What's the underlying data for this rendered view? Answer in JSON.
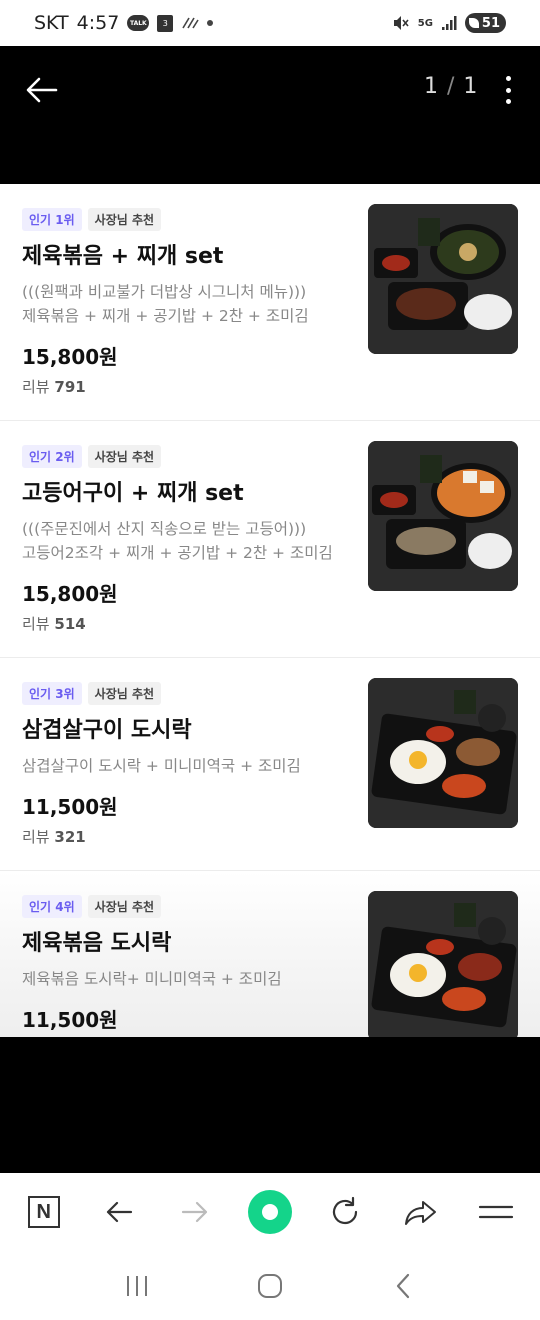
{
  "status_bar": {
    "carrier": "SKT",
    "time": "4:57",
    "talk_badge": "TALK",
    "calendar_day": "3",
    "network": "5G",
    "battery": "51"
  },
  "viewer": {
    "page_current": "1",
    "page_total": "1",
    "page_separator": "/"
  },
  "menu_items": [
    {
      "rank_badge": "인기 1위",
      "owner_badge": "사장님 추천",
      "title": "제육볶음 + 찌개 set",
      "desc_line1": "(((원팩과 비교불가 더밥상 시그니처 메뉴)))",
      "desc_line2": "제육볶음 + 찌개 + 공기밥 + 2찬 + 조미김",
      "price": "15,800원",
      "review_label": "리뷰",
      "review_count": "791"
    },
    {
      "rank_badge": "인기 2위",
      "owner_badge": "사장님 추천",
      "title": "고등어구이 + 찌개 set",
      "desc_line1": "(((주문진에서 산지 직송으로 받는 고등어)))",
      "desc_line2": "고등어2조각 + 찌개 + 공기밥 + 2찬 + 조미김",
      "price": "15,800원",
      "review_label": "리뷰",
      "review_count": "514"
    },
    {
      "rank_badge": "인기 3위",
      "owner_badge": "사장님 추천",
      "title": "삼겹살구이 도시락",
      "desc_line1": "삼겹살구이 도시락 + 미니미역국 + 조미김",
      "price": "11,500원",
      "review_label": "리뷰",
      "review_count": "321"
    },
    {
      "rank_badge": "인기 4위",
      "owner_badge": "사장님 추천",
      "title": "제육볶음 도시락",
      "desc_line1": "제육볶음 도시락+ 미니미역국 + 조미김",
      "price": "11,500원"
    }
  ],
  "toolbar": {
    "naver_label": "N"
  },
  "colors": {
    "rank_badge_text": "#6a5cf0",
    "green_button": "#14d48a",
    "viewer_background": "#000000"
  }
}
